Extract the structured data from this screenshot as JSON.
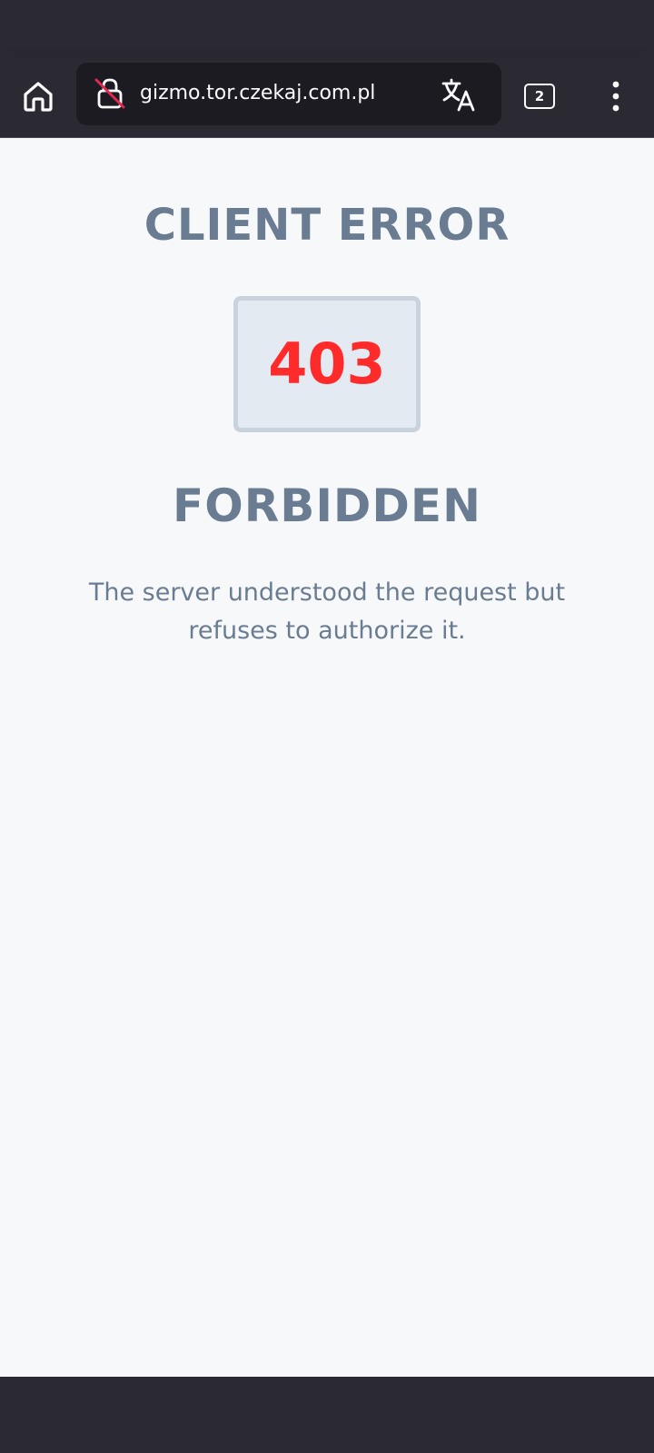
{
  "browser": {
    "url": "gizmo.tor.czekaj.com.pl",
    "tab_count": "2",
    "icons": {
      "home": "home-icon",
      "lock": "insecure-lock-icon",
      "translate": "translate-icon",
      "menu": "more-vertical-icon"
    },
    "colors": {
      "toolbar_bg": "#2b2a33",
      "url_bar_bg": "#1c1b22",
      "insecure_strike": "#e22850"
    }
  },
  "page": {
    "error_category": "CLIENT ERROR",
    "error_code": "403",
    "error_title": "FORBIDDEN",
    "error_description": "The server understood the request but refuses to authorize it.",
    "colors": {
      "background": "#f7f8fa",
      "text": "#6a7c91",
      "code": "#ff2a2a",
      "code_box_bg": "#e3eaf2",
      "code_box_border": "#c8d3de"
    }
  }
}
